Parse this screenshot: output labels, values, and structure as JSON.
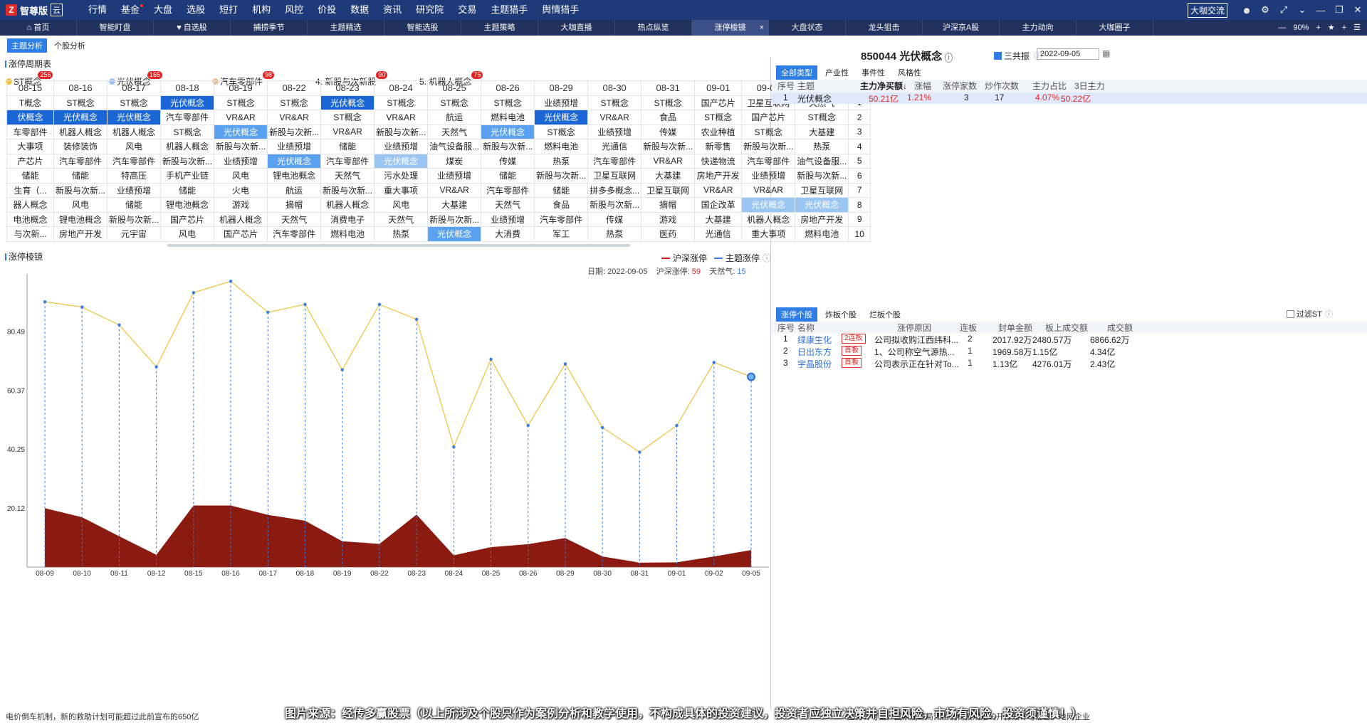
{
  "app": {
    "logo_char": "Z",
    "name": "智尊版",
    "cloud": "云"
  },
  "menu": [
    "行情",
    "基金",
    "大盘",
    "选股",
    "短打",
    "机构",
    "风控",
    "价投",
    "数据",
    "资讯",
    "研究院",
    "交易",
    "主题猎手",
    "舆情猎手"
  ],
  "top_right": {
    "exchange": "大咖交流"
  },
  "tabs": [
    "首页",
    "智能盯盘",
    "自选股",
    "捕捞季节",
    "主题精选",
    "智能选股",
    "主题策略",
    "大咖直播",
    "热点纵览",
    "涨停梭镜",
    "大盘状态",
    "龙头狙击",
    "沪深京A股",
    "主力动向",
    "大咖圈子"
  ],
  "active_tab": "涨停梭镜",
  "zoom": "90%",
  "subtabs": [
    "主题分析",
    "个股分析"
  ],
  "cycle": {
    "title": "涨停周期表",
    "themes": [
      {
        "label": "ST概念",
        "count": "256",
        "color": "#f0c040"
      },
      {
        "label": "光伏概念",
        "count": "165",
        "color": "#9ec4ef"
      },
      {
        "label": "汽车零部件",
        "count": "98",
        "color": "#e9c190"
      },
      {
        "label": "4. 新股与次新股",
        "count": "90"
      },
      {
        "label": "5. 机器人概念",
        "count": "75"
      }
    ],
    "dates": [
      "08-15",
      "08-16",
      "08-17",
      "08-18",
      "08-19",
      "08-22",
      "08-23",
      "08-24",
      "08-25",
      "08-26",
      "08-29",
      "08-30",
      "08-31",
      "09-01",
      "09-02",
      "09-05"
    ],
    "rank_label": "排名",
    "rows": [
      [
        "T概念",
        "ST概念",
        "ST概念",
        "光伏概念",
        "ST概念",
        "ST概念",
        "光伏概念",
        "ST概念",
        "ST概念",
        "ST概念",
        "业绩预增",
        "ST概念",
        "ST概念",
        "国产芯片",
        "卫星互联网",
        "天然气"
      ],
      [
        "伏概念",
        "光伏概念",
        "光伏概念",
        "汽车零部件",
        "VR&AR",
        "VR&AR",
        "ST概念",
        "VR&AR",
        "航运",
        "燃料电池",
        "光伏概念",
        "VR&AR",
        "食品",
        "ST概念",
        "国产芯片",
        "ST概念"
      ],
      [
        "车零部件",
        "机器人概念",
        "机器人概念",
        "ST概念",
        "光伏概念",
        "新股与次新...",
        "VR&AR",
        "新股与次新...",
        "天然气",
        "光伏概念",
        "ST概念",
        "业绩预增",
        "传媒",
        "农业种植",
        "ST概念",
        "大基建"
      ],
      [
        "大事项",
        "装修装饰",
        "风电",
        "机器人概念",
        "新股与次新...",
        "业绩预增",
        "储能",
        "业绩预增",
        "油气设备服...",
        "新股与次新...",
        "燃料电池",
        "光通信",
        "新股与次新...",
        "新零售",
        "新股与次新...",
        "热泵"
      ],
      [
        "产芯片",
        "汽车零部件",
        "汽车零部件",
        "新股与次新...",
        "业绩预增",
        "光伏概念",
        "汽车零部件",
        "光伏概念",
        "煤炭",
        "传媒",
        "热泵",
        "汽车零部件",
        "VR&AR",
        "快递物流",
        "汽车零部件",
        "油气设备服..."
      ],
      [
        "储能",
        "储能",
        "特高压",
        "手机产业链",
        "风电",
        "锂电池概念",
        "天然气",
        "污水处理",
        "业绩预增",
        "储能",
        "新股与次新...",
        "卫星互联网",
        "大基建",
        "房地产开发",
        "业绩预增",
        "新股与次新..."
      ],
      [
        "生育（...",
        "新股与次新...",
        "业绩预增",
        "储能",
        "火电",
        "航运",
        "新股与次新...",
        "重大事项",
        "VR&AR",
        "汽车零部件",
        "储能",
        "拼多多概念...",
        "卫星互联网",
        "VR&AR",
        "VR&AR",
        "卫星互联网"
      ],
      [
        "器人概念",
        "风电",
        "储能",
        "锂电池概念",
        "游戏",
        "摘帽",
        "机器人概念",
        "风电",
        "大基建",
        "天然气",
        "食品",
        "新股与次新...",
        "摘帽",
        "国企改革",
        "光伏概念",
        "光伏概念"
      ],
      [
        "电池概念",
        "锂电池概念",
        "新股与次新...",
        "国产芯片",
        "机器人概念",
        "天然气",
        "消费电子",
        "天然气",
        "新股与次新...",
        "业绩预增",
        "汽车零部件",
        "传媒",
        "游戏",
        "大基建",
        "机器人概念",
        "房地产开发"
      ],
      [
        "与次新...",
        "房地产开发",
        "元宇宙",
        "风电",
        "国产芯片",
        "汽车零部件",
        "燃料电池",
        "热泵",
        "光伏概念",
        "大消费",
        "军工",
        "热泵",
        "医药",
        "光通信",
        "重大事项",
        "燃料电池"
      ]
    ],
    "ranks": [
      "1",
      "2",
      "3",
      "4",
      "5",
      "6",
      "7",
      "8",
      "9",
      "10"
    ]
  },
  "mirror": {
    "title": "涨停棱镜",
    "legend": [
      {
        "label": "沪深涨停",
        "color": "#c81e1e"
      },
      {
        "label": "主题涨停",
        "color": "#3a7be0"
      }
    ],
    "date_label": "日期:",
    "date": "2022-09-05",
    "hs_label": "沪深涨停:",
    "hs_value": "59",
    "gas_label": "天然气:",
    "gas_value": "15"
  },
  "chart_data": {
    "type": "area",
    "x": [
      "08-09",
      "08-10",
      "08-11",
      "08-12",
      "08-15",
      "08-16",
      "08-17",
      "08-18",
      "08-19",
      "08-22",
      "08-23",
      "08-24",
      "08-25",
      "08-26",
      "08-29",
      "08-30",
      "08-31",
      "09-01",
      "09-02",
      "09-05"
    ],
    "yticks": [
      "80.49",
      "60.37",
      "40.25",
      "20.12"
    ],
    "series": [
      {
        "name": "沪深涨停",
        "type": "area",
        "color": "#8b1a10",
        "values": [
          20.1,
          17.0,
          10.5,
          4.2,
          21.0,
          21.0,
          17.8,
          15.8,
          8.8,
          7.9,
          17.9,
          4.0,
          6.8,
          7.8,
          9.9,
          3.6,
          1.5,
          1.6,
          3.6,
          5.8
        ]
      },
      {
        "name": "主题涨停",
        "type": "line",
        "color": "#f0c23a",
        "values": [
          90.5,
          88.7,
          82.6,
          68.3,
          93.6,
          97.5,
          86.9,
          89.6,
          67.3,
          89.6,
          84.5,
          41.0,
          70.9,
          48.3,
          69.3,
          47.6,
          39.2,
          48.3,
          69.8,
          64.9
        ]
      }
    ],
    "ylim": [
      0,
      100
    ]
  },
  "right": {
    "code_title": "850044 光伏概念",
    "checkbox_label": "三共振",
    "date": "2022-09-05",
    "type_tabs": [
      "全部类型",
      "产业性",
      "事件性",
      "风格性"
    ],
    "headers": [
      "序号",
      "主题",
      "主力净买额↓",
      "涨幅",
      "涨停家数",
      "炒作次数",
      "主力占比",
      "3日主力"
    ],
    "row": [
      "1",
      "光伏概念",
      "50.21亿",
      "1.21%",
      "3",
      "17",
      "4.07%",
      "50.22亿"
    ],
    "stock_tabs": [
      "涨停个股",
      "炸板个股",
      "烂板个股"
    ],
    "filter_label": "过滤ST",
    "stock_headers": [
      "序号",
      "名称",
      "涨停原因",
      "连板",
      "封单金额",
      "板上成交额",
      "成交额"
    ],
    "stocks": [
      [
        "1",
        "绿康生化",
        "2连板",
        "公司拟收购江西纬科...",
        "2",
        "2017.92万",
        "2480.57万",
        "6866.62万"
      ],
      [
        "2",
        "日出东方",
        "首板",
        "1、公司称空气源热...",
        "1",
        "1969.58万",
        "1.15亿",
        "4.34亿"
      ],
      [
        "3",
        "宇晶股份",
        "首板",
        "公司表示正在针对To...",
        "1",
        "1.13亿",
        "4276.01万",
        "2.43亿"
      ]
    ]
  },
  "ticker": "电价倒车机制，新的救助计划可能超过此前宣布的650亿",
  "ticker_tail": "业务许可证，国家能源局派出机构按规定公开行政许可信息。电网企业",
  "note": "图片来源：经传多赢股票（以上所涉及个股只作为案例分析和教学使用，不构成具体的投资建议，投资者应独立决策并自担风险，市场有风险，投资须谨慎！）"
}
